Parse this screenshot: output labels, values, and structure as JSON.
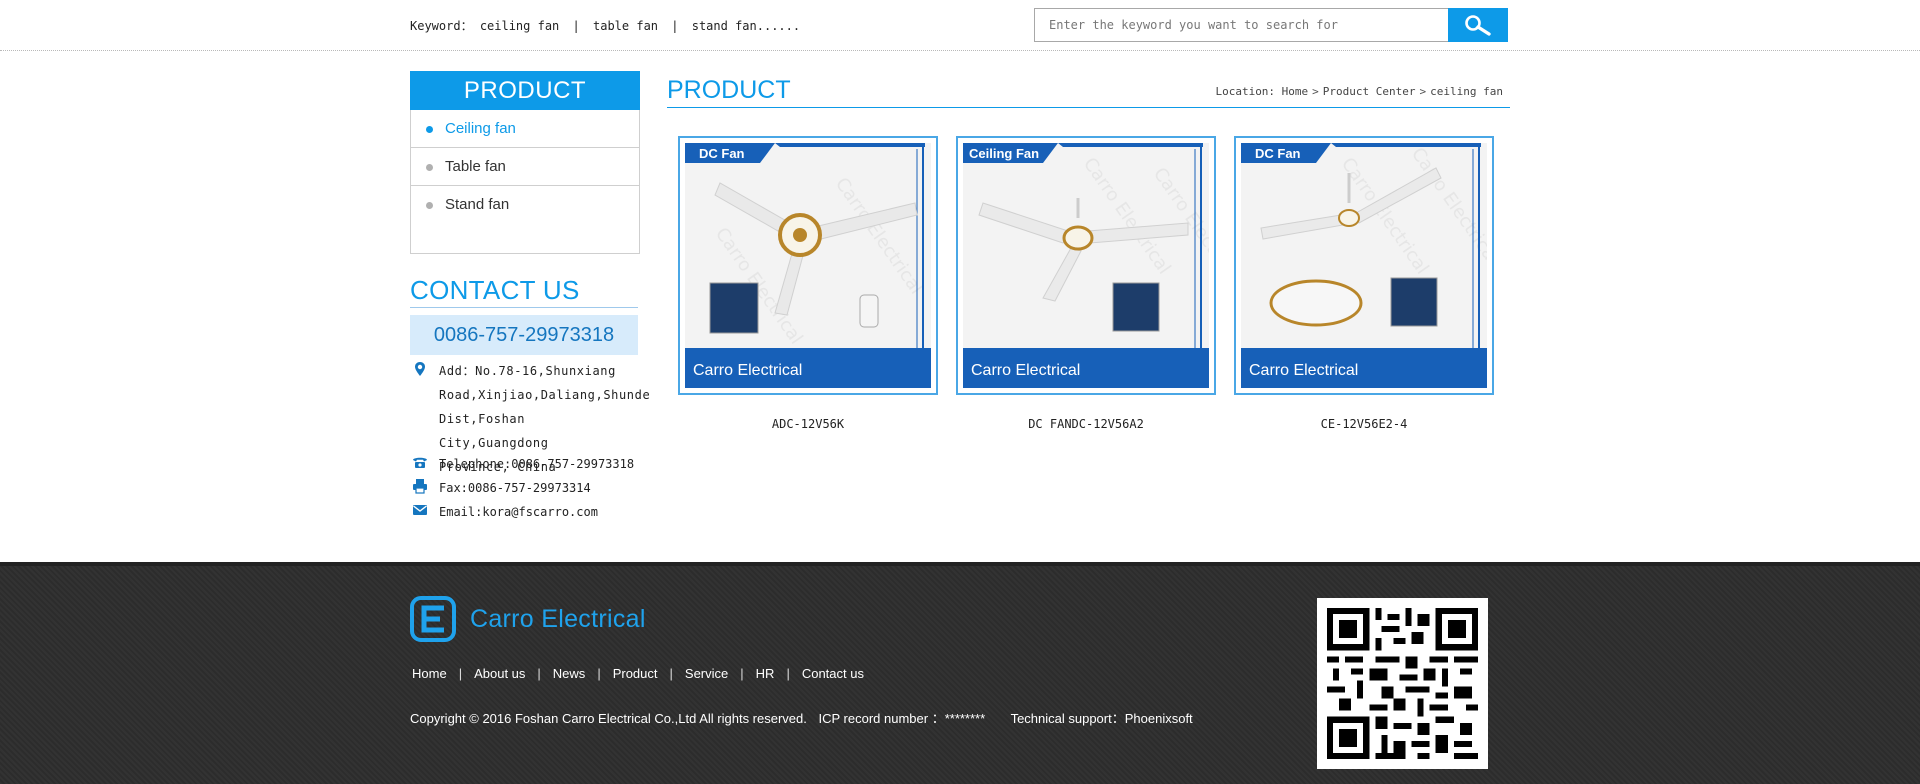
{
  "header": {
    "keyword_label": "Keyword：",
    "keywords": [
      "ceiling fan",
      "table fan",
      "stand fan......"
    ],
    "search_placeholder": "Enter the keyword you want to search for"
  },
  "sidebar": {
    "category_title": "PRODUCT",
    "categories": [
      {
        "label": "Ceiling fan",
        "active": true
      },
      {
        "label": "Table fan",
        "active": false
      },
      {
        "label": "Stand fan",
        "active": false
      }
    ],
    "contact_title": "CONTACT US",
    "phone": "0086-757-29973318",
    "address_lines": [
      "Add：No.78-16,Shunxiang",
      "Road,Xinjiao,Daliang,Shunde",
      "Dist,Foshan  City,Guangdong",
      "Province, China"
    ],
    "telephone": "Telephone:0086-757-29973318",
    "fax": "Fax:0086-757-29973314",
    "email": "Email:kora@fscarro.com"
  },
  "main": {
    "title": "PRODUCT",
    "breadcrumb": [
      "Location: Home",
      "Product Center",
      "ceiling fan"
    ],
    "products": [
      {
        "name": "ADC-12V56K",
        "tag": "DC Fan",
        "brand": "Carro Electrical"
      },
      {
        "name": "DC FANDC-12V56A2",
        "tag": "Ceiling Fan",
        "brand": "Carro Electrical"
      },
      {
        "name": "CE-12V56E2-4",
        "tag": "DC Fan",
        "brand": "Carro Electrical"
      }
    ]
  },
  "footer": {
    "logo_text": "Carro Electrical",
    "nav": [
      "Home",
      "About us",
      "News",
      "Product",
      "Service",
      "HR",
      "Contact us"
    ],
    "copyright": "Copyright © 2016 Foshan Carro Electrical Co.,Ltd All rights reserved.",
    "icp": "ICP record number ：********",
    "support": "Technical support：Phoenixsoft"
  },
  "colors": {
    "accent": "#0d9ae8",
    "footer_bg": "#2c2c2c",
    "light_blue": "#d7ebfb"
  },
  "icons": {
    "search": "magnifier-icon",
    "address": "map-pin-icon",
    "telephone": "phone-icon",
    "fax": "fax-icon",
    "email": "envelope-icon"
  }
}
